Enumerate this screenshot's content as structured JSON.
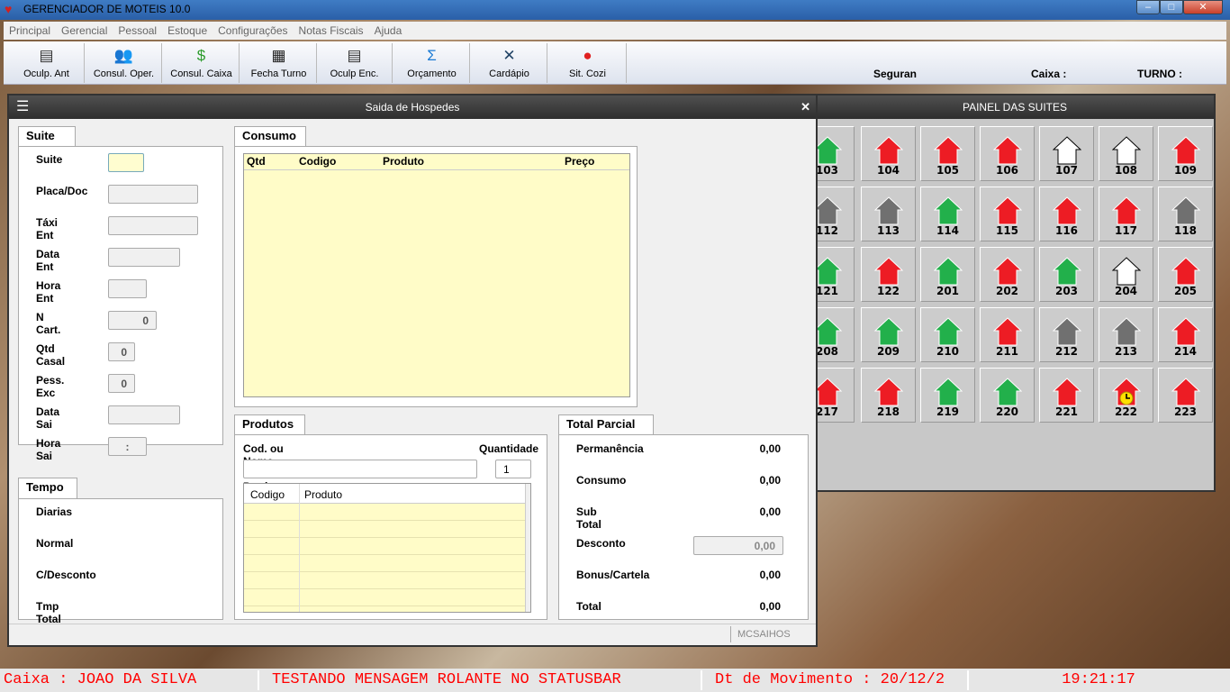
{
  "window": {
    "title": "GERENCIADOR DE MOTEIS 10.0"
  },
  "menu": [
    "Principal",
    "Gerencial",
    "Pessoal",
    "Estoque",
    "Configurações",
    "Notas Fiscais",
    "Ajuda"
  ],
  "toolbar": {
    "buttons": [
      {
        "label": "Oculp. Ant",
        "icon": "notebook-icon",
        "glyph": "▤",
        "color": "#333"
      },
      {
        "label": "Consul. Oper.",
        "icon": "users-icon",
        "glyph": "👥",
        "color": "#3a8"
      },
      {
        "label": "Consul. Caixa",
        "icon": "dollar-icon",
        "glyph": "$",
        "color": "#2a9a2a"
      },
      {
        "label": "Fecha Turno",
        "icon": "cash-register-icon",
        "glyph": "▦",
        "color": "#222"
      },
      {
        "label": "Oculp Enc.",
        "icon": "notebook-icon",
        "glyph": "▤",
        "color": "#333"
      },
      {
        "label": "Orçamento",
        "icon": "sigma-icon",
        "glyph": "Σ",
        "color": "#1a7ad4"
      },
      {
        "label": "Cardápio",
        "icon": "menu-book-icon",
        "glyph": "✕",
        "color": "#246"
      },
      {
        "label": "Sit. Cozi",
        "icon": "chef-hat-icon",
        "glyph": "●",
        "color": "#e02020"
      }
    ],
    "seguran": "Seguran",
    "caixa": "Caixa :",
    "turno": "TURNO :"
  },
  "dialog": {
    "title": "Saida de Hospedes",
    "suite_tab": "Suite",
    "fields": [
      {
        "label": "Suite",
        "value": ""
      },
      {
        "label": "Placa/Doc",
        "value": ""
      },
      {
        "label": "Táxi Ent",
        "value": ""
      },
      {
        "label": "Data Ent",
        "value": ""
      },
      {
        "label": "Hora Ent",
        "value": ""
      },
      {
        "label": "N Cart.",
        "value": "0"
      },
      {
        "label": "Qtd Casal",
        "value": "0"
      },
      {
        "label": "Pess. Exc",
        "value": "0"
      },
      {
        "label": "Data Sai",
        "value": ""
      },
      {
        "label": "Hora Sai",
        "value": ":"
      }
    ],
    "tempo_tab": "Tempo",
    "tempo": [
      "Diarias",
      "Normal",
      "C/Desconto",
      "Tmp Total"
    ],
    "consumo_tab": "Consumo",
    "consumo_cols": [
      "Qtd",
      "Codigo",
      "Produto",
      "Preço"
    ],
    "produtos_tab": "Produtos",
    "produto_label": "Cod. ou Nome do Produto",
    "quantidade_label": "Quantidade",
    "produto_value": "",
    "quantidade_value": "1",
    "produtos_cols": [
      "Codigo",
      "Produto"
    ],
    "total_tab": "Total Parcial",
    "totals": [
      {
        "label": "Permanência",
        "value": "0,00"
      },
      {
        "label": "Consumo",
        "value": "0,00"
      },
      {
        "label": "Sub Total",
        "value": "0,00"
      },
      {
        "label": "Desconto",
        "value": "0,00"
      },
      {
        "label": "Bonus/Cartela",
        "value": "0,00"
      },
      {
        "label": "Total",
        "value": "0,00"
      }
    ],
    "status_panel": "MCSAIHOS"
  },
  "panel": {
    "title": "PAINEL DAS SUITES",
    "colors": {
      "green": "#22b04b",
      "red": "#ed1c24",
      "gray": "#707070",
      "white": "#ffffff"
    },
    "suites": [
      [
        "103",
        "green"
      ],
      [
        "104",
        "red"
      ],
      [
        "105",
        "red"
      ],
      [
        "106",
        "red"
      ],
      [
        "107",
        "white"
      ],
      [
        "108",
        "white"
      ],
      [
        "109",
        "red"
      ],
      [
        "112",
        "gray"
      ],
      [
        "113",
        "gray"
      ],
      [
        "114",
        "green"
      ],
      [
        "115",
        "red"
      ],
      [
        "116",
        "red"
      ],
      [
        "117",
        "red"
      ],
      [
        "118",
        "gray"
      ],
      [
        "121",
        "green"
      ],
      [
        "122",
        "red"
      ],
      [
        "201",
        "green"
      ],
      [
        "202",
        "red"
      ],
      [
        "203",
        "green"
      ],
      [
        "204",
        "white"
      ],
      [
        "205",
        "red"
      ],
      [
        "208",
        "green"
      ],
      [
        "209",
        "green"
      ],
      [
        "210",
        "green"
      ],
      [
        "211",
        "red"
      ],
      [
        "212",
        "gray"
      ],
      [
        "213",
        "gray"
      ],
      [
        "214",
        "red"
      ],
      [
        "217",
        "red"
      ],
      [
        "218",
        "red"
      ],
      [
        "219",
        "green"
      ],
      [
        "220",
        "green"
      ],
      [
        "221",
        "red"
      ],
      [
        "222",
        "red-clock"
      ],
      [
        "223",
        "red"
      ]
    ]
  },
  "statusbar": {
    "caixa": "Caixa : JOAO DA SILVA",
    "message": "TESTANDO MENSAGEM ROLANTE NO STATUSBAR",
    "movimento": "Dt de Movimento : 20/12/2",
    "time": "19:21:17"
  }
}
